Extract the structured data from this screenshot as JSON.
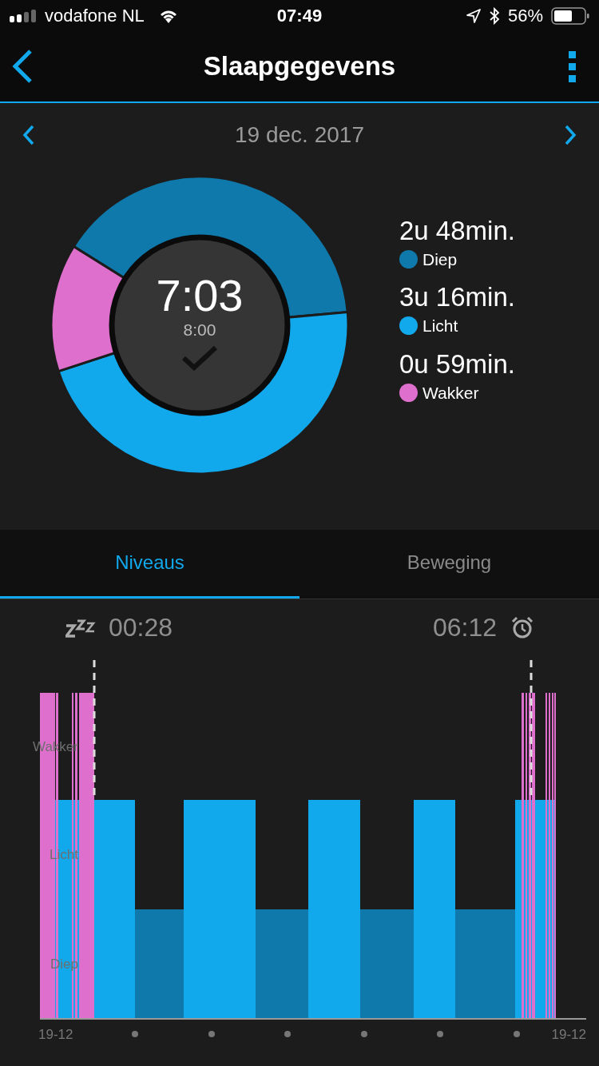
{
  "status_bar": {
    "carrier": "vodafone NL",
    "time": "07:49",
    "battery": "56%"
  },
  "header": {
    "title": "Slaapgegevens"
  },
  "date": "19 dec. 2017",
  "summary": {
    "total": "7:03",
    "goal": "8:00"
  },
  "chart_data": {
    "type": "donut",
    "categories": [
      "Diep",
      "Licht",
      "Wakker"
    ],
    "values": [
      39.7,
      46.4,
      13.9
    ]
  },
  "legend": [
    {
      "value": "2u 48min.",
      "color": "#0f79ab"
    },
    {
      "value": "3u 16min.",
      "color": "#11a8ec"
    },
    {
      "value": "0u 59min.",
      "color": "#df6fcc"
    }
  ],
  "tabs": [
    {
      "label": "Niveaus",
      "selected": true
    },
    {
      "label": "Beweging",
      "selected": false
    }
  ],
  "hypnogram": {
    "start": "00:28",
    "end": "06:12",
    "levels": [
      "Wakker",
      "Licht",
      "Diep"
    ],
    "x_labels": [
      "19-12",
      "19-12"
    ]
  }
}
